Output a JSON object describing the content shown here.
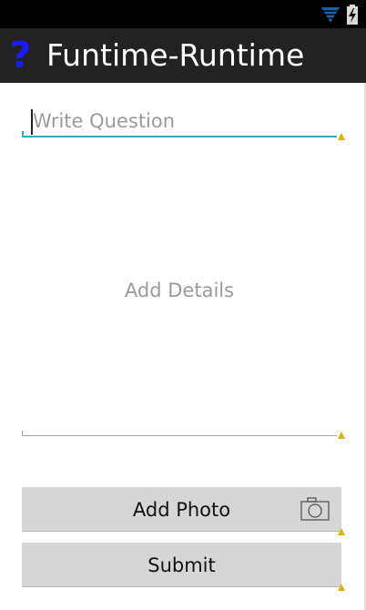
{
  "app": {
    "title": "Funtime-Runtime",
    "icon_glyph": "?",
    "icon": "question-mark-icon",
    "accent_color": "#1a1aff"
  },
  "status_bar": {
    "icons": [
      "wifi-icon",
      "battery-charging-icon"
    ]
  },
  "form": {
    "question": {
      "value": "",
      "placeholder": "Write Question",
      "underline_color": "#33a8c8"
    },
    "details": {
      "value": "",
      "placeholder": "Add Details"
    },
    "add_photo_label": "Add Photo",
    "add_photo_icon": "camera-icon",
    "submit_label": "Submit",
    "warning_icon": "warning-icon",
    "warning_color": "#d9b400"
  }
}
